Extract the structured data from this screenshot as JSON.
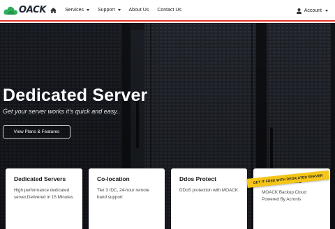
{
  "brand": {
    "name": "OACK",
    "accent": "#e8352b",
    "logo_color": "#2eaf5a"
  },
  "nav": {
    "items": [
      {
        "label": "Services",
        "has_dropdown": true
      },
      {
        "label": "Support",
        "has_dropdown": true
      },
      {
        "label": "About Us",
        "has_dropdown": false
      },
      {
        "label": "Contact Us",
        "has_dropdown": false
      }
    ],
    "account_label": "Account"
  },
  "hero": {
    "title": "Dedicated Server",
    "subtitle": "Get your server works it's quick and easy..",
    "button_label": "View Plans & Features"
  },
  "cards": [
    {
      "title": "Dedicated Servers",
      "desc": "High performance dedicated server,Delivered in 15 Minutes"
    },
    {
      "title": "Co-location",
      "desc": "Tier 3 IDC, 24-hour remote hand support"
    },
    {
      "title": "Ddos Protect",
      "desc": "DDoS protection with MOACK"
    },
    {
      "title": "Backup Cloud",
      "desc": "MOACK Backup Cloud Powered By Acronis"
    }
  ],
  "ribbon_label": "GET IT FREE WITH DEDICATED SERVER"
}
